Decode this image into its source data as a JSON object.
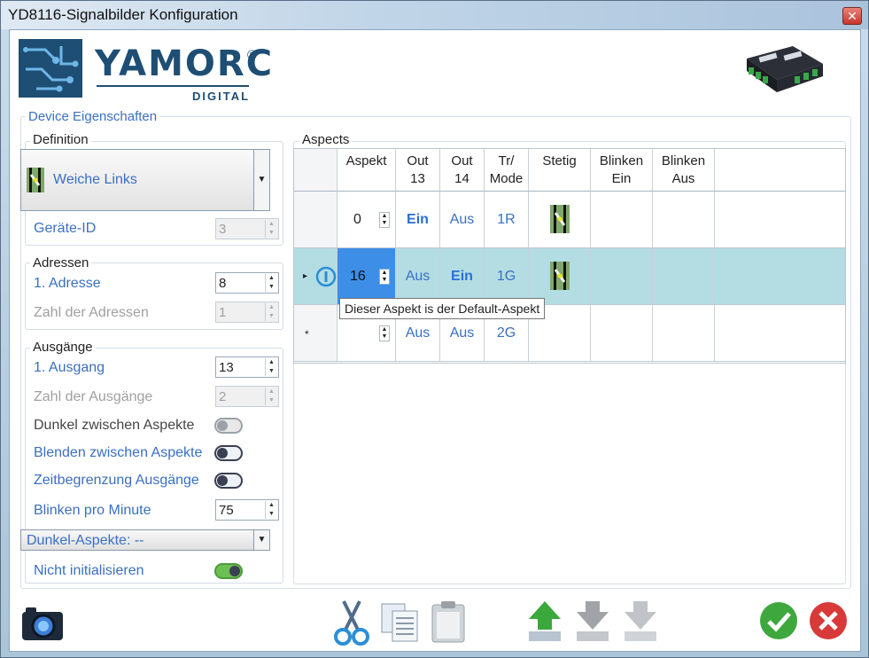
{
  "window": {
    "title": "YD8116-Signalbilder Konfiguration",
    "close_glyph": "✕"
  },
  "logo": {
    "name": "YAMORC",
    "reg": "®",
    "sub": "DIGITAL"
  },
  "device_group": {
    "title": "Device Eigenschaften"
  },
  "definition": {
    "title": "Definition",
    "selected": "Weiche Links",
    "geraete_id_label": "Geräte-ID",
    "geraete_id_value": "3"
  },
  "adressen": {
    "title": "Adressen",
    "first_label": "1. Adresse",
    "first_value": "8",
    "count_label": "Zahl der Adressen",
    "count_value": "1"
  },
  "ausgaenge": {
    "title": "Ausgänge",
    "first_label": "1. Ausgang",
    "first_value": "13",
    "count_label": "Zahl der Ausgänge",
    "count_value": "2",
    "dunkel_label": "Dunkel zwischen Aspekte",
    "blenden_label": "Blenden zwischen Aspekte",
    "zeit_label": "Zeitbegrenzung Ausgänge",
    "blinken_label": "Blinken pro Minute",
    "blinken_value": "75",
    "dunkel_aspekte": "Dunkel-Aspekte: --",
    "nicht_init_label": "Nicht initialisieren"
  },
  "aspects": {
    "title": "Aspects",
    "columns": [
      {
        "l1": "Aspekt",
        "l2": ""
      },
      {
        "l1": "Out",
        "l2": "13"
      },
      {
        "l1": "Out",
        "l2": "14"
      },
      {
        "l1": "Tr/",
        "l2": "Mode"
      },
      {
        "l1": "Stetig",
        "l2": ""
      },
      {
        "l1": "Blinken",
        "l2": "Ein"
      },
      {
        "l1": "Blinken",
        "l2": "Aus"
      }
    ],
    "rows": [
      {
        "aspekt": "0",
        "out13": "Ein",
        "out14": "Aus",
        "mode": "1R"
      },
      {
        "aspekt": "16",
        "out13": "Aus",
        "out14": "Ein",
        "mode": "1G"
      },
      {
        "aspekt": "",
        "out13": "Aus",
        "out14": "Aus",
        "mode": "2G"
      }
    ],
    "new_row_marker": "*",
    "current_row_marker": "▸",
    "tooltip": "Dieser Aspekt is der Default-Aspekt"
  },
  "icons": {
    "camera": "camera-icon",
    "cut": "scissors-icon",
    "copy": "copy-icon",
    "paste": "clipboard-icon",
    "up": "arrow-up-icon",
    "down": "arrow-down-icon",
    "down2": "arrow-down-end-icon",
    "ok": "checkmark-icon",
    "cancel": "cancel-icon"
  },
  "colors": {
    "accent_blue": "#3a6fc2",
    "selection": "#b3dde3",
    "bold_blue": "#2a6fd6"
  }
}
